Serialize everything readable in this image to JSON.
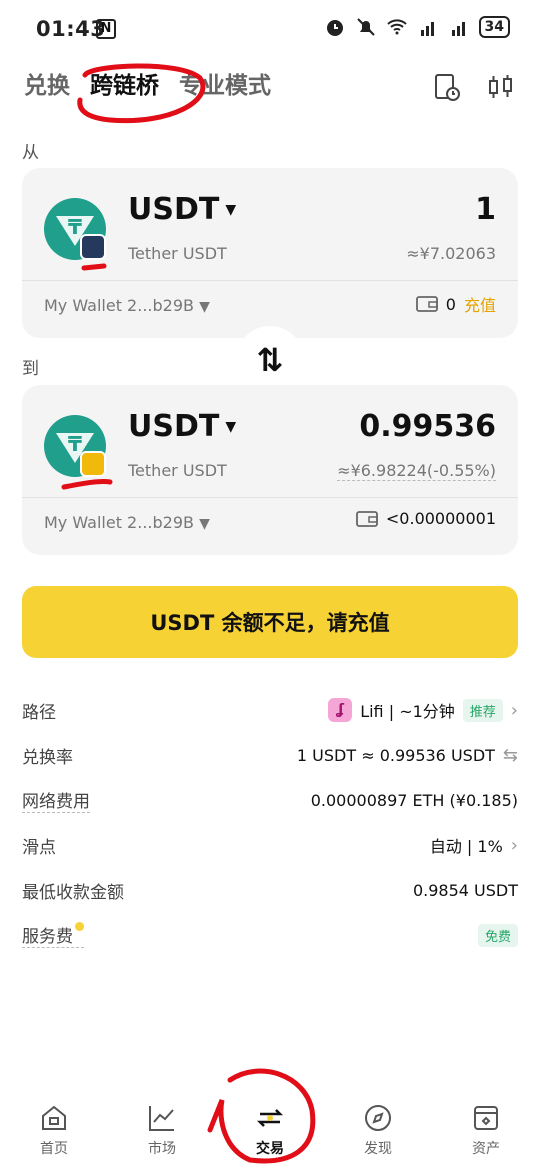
{
  "status": {
    "time": "01:43",
    "nfc": "N",
    "battery": "34"
  },
  "tabs": [
    {
      "label": "兑换"
    },
    {
      "label": "跨链桥"
    },
    {
      "label": "专业模式"
    }
  ],
  "from": {
    "section_label": "从",
    "symbol": "USDT",
    "full_name": "Tether USDT",
    "amount": "1",
    "fiat": "≈¥7.02063",
    "wallet": "My Wallet 2...b29B",
    "balance": "0",
    "recharge": "充值"
  },
  "to": {
    "section_label": "到",
    "symbol": "USDT",
    "full_name": "Tether USDT",
    "amount": "0.99536",
    "fiat": "≈¥6.98224(-0.55%)",
    "wallet": "My Wallet 2...b29B",
    "balance": "<0.00000001"
  },
  "swap_icon": "⇅",
  "main_button": "USDT 余额不足，请充值",
  "details": {
    "route_label": "路径",
    "route_value": "Lifi | ~1分钟",
    "route_tag": "推荐",
    "rate_label": "兑换率",
    "rate_value": "1 USDT ≈ 0.99536 USDT",
    "fee_label": "网络费用",
    "fee_value": "0.00000897 ETH (¥0.185)",
    "slippage_label": "滑点",
    "slippage_value": "自动 | 1%",
    "min_label": "最低收款金额",
    "min_value": "0.9854 USDT",
    "service_label": "服务费",
    "service_value": "免费"
  },
  "nav": [
    {
      "label": "首页"
    },
    {
      "label": "市场"
    },
    {
      "label": "交易"
    },
    {
      "label": "发现"
    },
    {
      "label": "资产"
    }
  ],
  "colors": {
    "accent": "#f7d235",
    "tether": "#1f9f8c",
    "annotation": "#e10d17",
    "recharge": "#e5a300"
  }
}
